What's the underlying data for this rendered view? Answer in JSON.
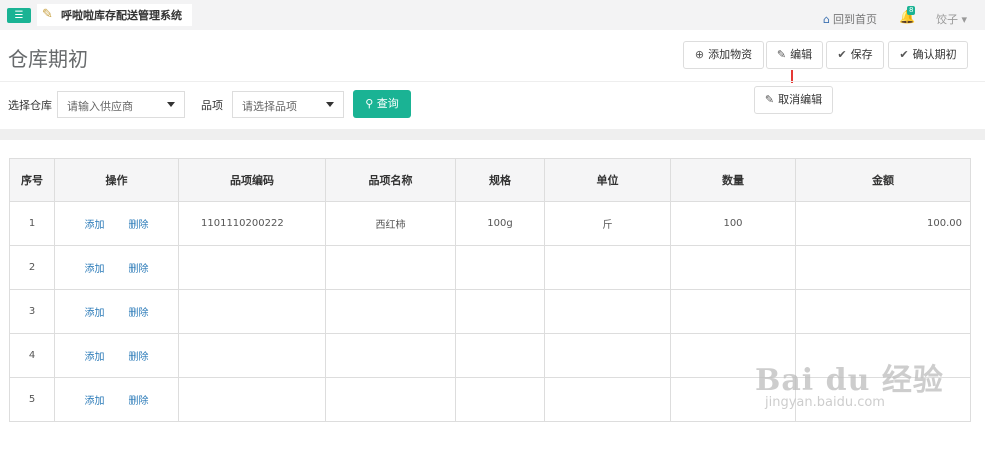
{
  "topbar": {
    "menu_icon": "hamburger-icon",
    "app_title": "呼啦啦库存配送管理系统",
    "home_label": "回到首页",
    "notification_count": "8",
    "user_name": "饺子"
  },
  "page": {
    "title": "仓库期初"
  },
  "toolbar": {
    "add_label": "添加物资",
    "edit_label": "编辑",
    "save_label": "保存",
    "confirm_label": "确认期初",
    "cancel_edit_label": "取消编辑"
  },
  "filters": {
    "warehouse_label": "选择仓库",
    "warehouse_placeholder": "请输入供应商",
    "item_label": "品项",
    "item_placeholder": "请选择品项",
    "query_label": "查询"
  },
  "table": {
    "columns": [
      "序号",
      "操作",
      "品项编码",
      "品项名称",
      "规格",
      "单位",
      "数量",
      "金额"
    ],
    "add_label": "添加",
    "delete_label": "删除",
    "rows": [
      {
        "no": "1",
        "code": "1101110200222",
        "name": "西红柿",
        "spec": "100g",
        "unit": "斤",
        "qty": "100",
        "amount": "100.00"
      },
      {
        "no": "2",
        "code": "",
        "name": "",
        "spec": "",
        "unit": "",
        "qty": "",
        "amount": ""
      },
      {
        "no": "3",
        "code": "",
        "name": "",
        "spec": "",
        "unit": "",
        "qty": "",
        "amount": ""
      },
      {
        "no": "4",
        "code": "",
        "name": "",
        "spec": "",
        "unit": "",
        "qty": "",
        "amount": ""
      },
      {
        "no": "5",
        "code": "",
        "name": "",
        "spec": "",
        "unit": "",
        "qty": "",
        "amount": ""
      }
    ]
  },
  "watermark": {
    "brand": "Bai du 经验",
    "url": "jingyan.baidu.com"
  },
  "colors": {
    "accent": "#1ab394",
    "link": "#2a7ab8",
    "marker": "#e53935"
  }
}
